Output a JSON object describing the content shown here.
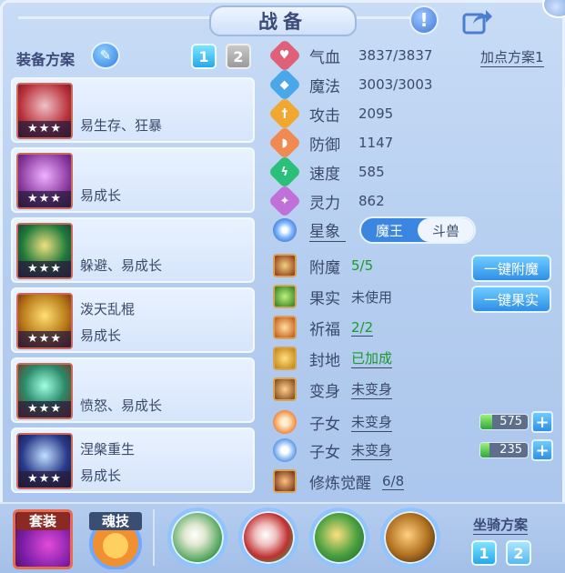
{
  "title": "战备",
  "equip": {
    "label": "装备方案",
    "scheme_buttons": [
      "1",
      "2"
    ],
    "items": [
      {
        "name": "",
        "desc": "易生存、狂暴",
        "stars": "★★★",
        "color": "#b8313a"
      },
      {
        "name": "",
        "desc": "易成长",
        "stars": "★★★",
        "color": "#8a3aa0"
      },
      {
        "name": "",
        "desc": "躲避、易成长",
        "stars": "★★★",
        "color": "#1e7a3a"
      },
      {
        "name": "泼天乱棍",
        "desc": "易成长",
        "stars": "★★★",
        "color": "#b87a1a"
      },
      {
        "name": "",
        "desc": "愤怒、易成长",
        "stars": "★★★",
        "color": "#2a8a6a"
      },
      {
        "name": "涅槃重生",
        "desc": "易成长",
        "stars": "★★★",
        "color": "#2a3a8a"
      }
    ]
  },
  "stats": {
    "plan_link": "加点方案1",
    "rows": [
      {
        "label": "气血",
        "value": "3837/3837",
        "icon": "heart-icon",
        "color": "#e0607a"
      },
      {
        "label": "魔法",
        "value": "3003/3003",
        "icon": "mana-icon",
        "color": "#4aa8e8"
      },
      {
        "label": "攻击",
        "value": "2095",
        "icon": "sword-icon",
        "color": "#f0a830"
      },
      {
        "label": "防御",
        "value": "1147",
        "icon": "shield-icon",
        "color": "#f08a50"
      },
      {
        "label": "速度",
        "value": "585",
        "icon": "speed-icon",
        "color": "#2ac07a"
      },
      {
        "label": "灵力",
        "value": "862",
        "icon": "spirit-icon",
        "color": "#c070d8"
      }
    ],
    "star_label": "星象",
    "star_options": [
      "魔王",
      "斗兽"
    ]
  },
  "buffs": [
    {
      "label": "附魔",
      "value": "5/5",
      "style": "green",
      "icon": "enchant-icon"
    },
    {
      "label": "果实",
      "value": "未使用",
      "style": "plain",
      "icon": "fruit-icon"
    },
    {
      "label": "祈福",
      "value": "2/2",
      "style": "green-ul",
      "icon": "blessing-icon"
    },
    {
      "label": "封地",
      "value": "已加成",
      "style": "green-ul",
      "icon": "fief-icon"
    },
    {
      "label": "变身",
      "value": "未变身",
      "style": "ul",
      "icon": "transform-icon"
    },
    {
      "label": "子女",
      "value": "未变身",
      "style": "ul",
      "icon": "child-icon"
    },
    {
      "label": "子女",
      "value": "未变身",
      "style": "ul",
      "icon": "child-icon"
    },
    {
      "label": "修炼觉醒",
      "value": "6/8",
      "style": "ul",
      "icon": "cultivate-icon"
    }
  ],
  "buttons": {
    "enchant": "一键附魔",
    "fruit": "一键果实"
  },
  "bars": [
    {
      "value": "575",
      "fill": 0.25
    },
    {
      "value": "235",
      "fill": 0.2
    }
  ],
  "bottom": {
    "set_label": "套装",
    "soul_label": "魂技",
    "mount_label": "坐骑方案",
    "mount_buttons": [
      "1",
      "2"
    ]
  }
}
